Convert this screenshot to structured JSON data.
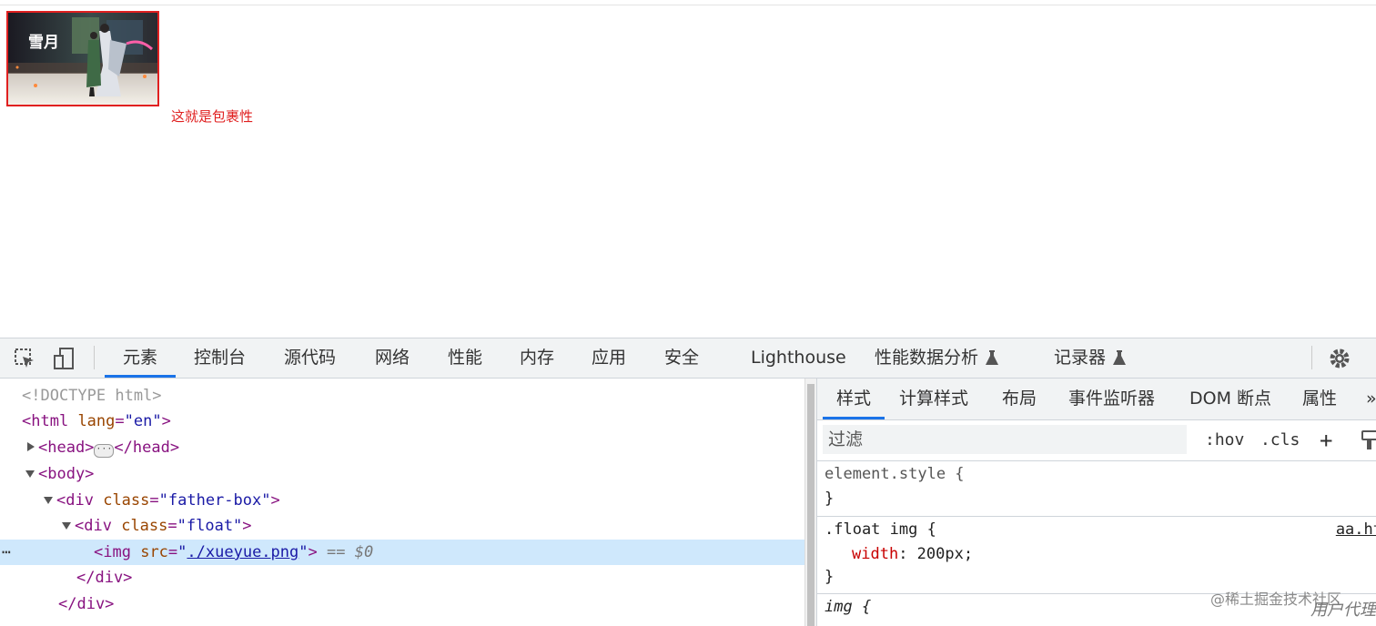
{
  "page": {
    "image_caption": "雪月",
    "wrap_text": "这就是包裹性"
  },
  "devtools": {
    "tabs": [
      "元素",
      "控制台",
      "源代码",
      "网络",
      "性能",
      "内存",
      "应用",
      "安全",
      "Lighthouse",
      "性能数据分析",
      "记录器"
    ],
    "active_tab": "元素",
    "elements": {
      "doctype": "<!DOCTYPE html>",
      "html_open": "<html",
      "lang_attr": "lang",
      "lang_val": "\"en\"",
      "head_open": "<head>",
      "head_close": "</head>",
      "body_open": "<body>",
      "div_open": "<div",
      "class_attr": "class",
      "father_val": "\"father-box\"",
      "float_val": "\"float\"",
      "gt": ">",
      "img_open": "<img",
      "src_attr": "src",
      "src_val": "./xueyue.png",
      "selected_marker": "== $0",
      "div_close": "</div>",
      "eq": "=",
      "quote": "\"",
      "dots": "⋯"
    },
    "styles": {
      "subtabs": [
        "样式",
        "计算样式",
        "布局",
        "事件监听器",
        "DOM 断点",
        "属性",
        "»"
      ],
      "filter_placeholder": "过滤",
      "hov": ":hov",
      "cls": ".cls",
      "plus": "+",
      "element_style_selector": "element.style {",
      "close_brace": "}",
      "float_img_selector": ".float img {",
      "source_link": "aa.ht",
      "width_prop": "width",
      "width_value": ": 200px;",
      "img_selector": "img {"
    },
    "watermark": "@稀土掘金技术社区",
    "watermark2": "用户代理"
  }
}
